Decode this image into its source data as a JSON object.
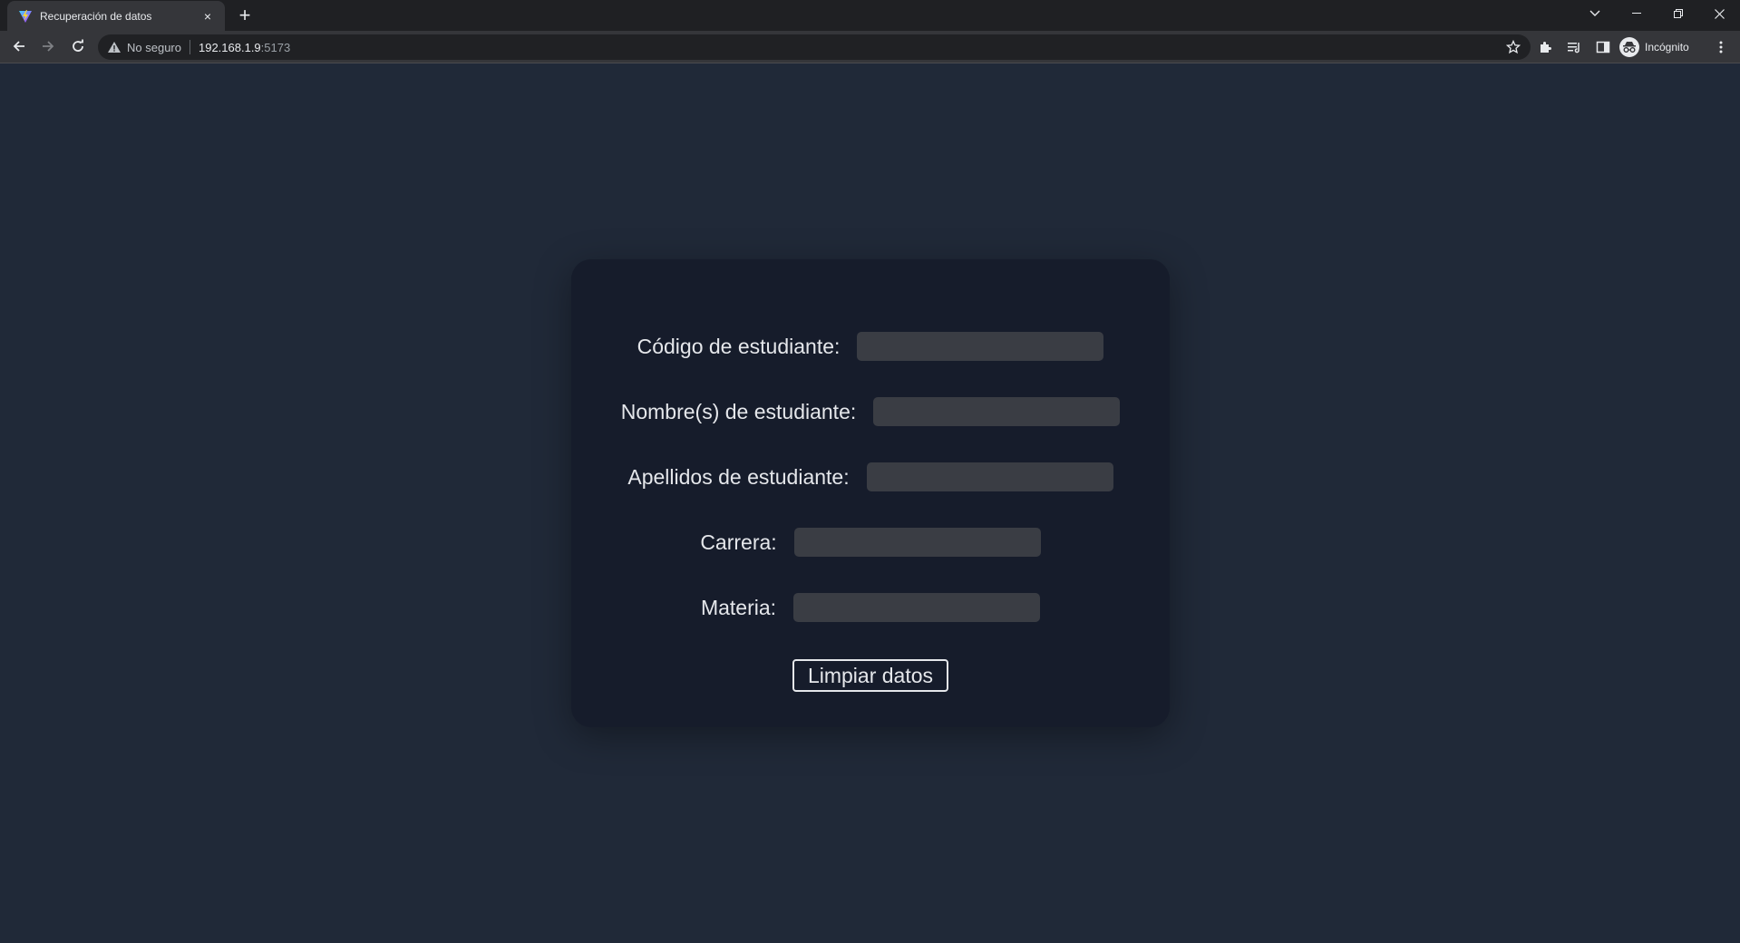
{
  "browser": {
    "tab": {
      "title": "Recuperación de datos",
      "close": "×"
    },
    "new_tab": "+",
    "address": {
      "security": "No seguro",
      "host": "192.168.1.9",
      "port": ":5173"
    },
    "profile": "Incógnito"
  },
  "form": {
    "fields": [
      {
        "label": "Código de estudiante:",
        "value": ""
      },
      {
        "label": "Nombre(s) de estudiante:",
        "value": ""
      },
      {
        "label": "Apellidos de estudiante:",
        "value": ""
      },
      {
        "label": "Carrera:",
        "value": ""
      },
      {
        "label": "Materia:",
        "value": ""
      }
    ],
    "clear_button": "Limpiar datos"
  },
  "colors": {
    "page_background": "#202938",
    "card_background": "#161c2b",
    "input_background": "#3a3d44",
    "text": "#e5e7eb"
  }
}
